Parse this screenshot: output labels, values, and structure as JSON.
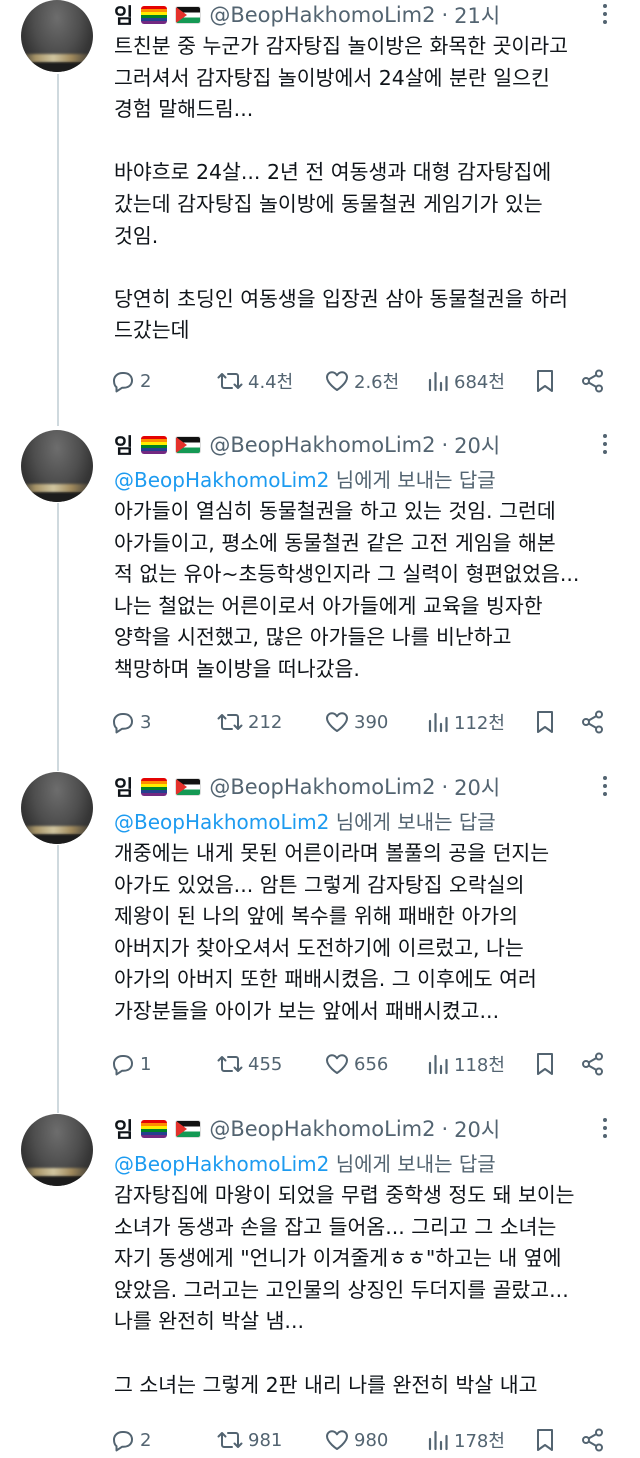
{
  "tweets": [
    {
      "name": "임",
      "handle": "@BeopHakhomoLim2",
      "time": "21시",
      "reply_to": null,
      "reply_to_suffix": null,
      "lines": [
        "트친분 중 누군가 감자탕집 놀이방은 화목한 곳이라고",
        "그러셔서 감자탕집 놀이방에서 24살에 분란 일으킨",
        "경험 말해드림...",
        "",
        "바야흐로 24살... 2년 전 여동생과 대형 감자탕집에",
        "갔는데 감자탕집 놀이방에 동물철권 게임기가 있는",
        "것임.",
        "",
        "당연히 초딩인 여동생을 입장권 삼아 동물철권을 하러",
        "드갔는데"
      ],
      "replies": "2",
      "retweets": "4.4천",
      "likes": "2.6천",
      "views": "684천"
    },
    {
      "name": "임",
      "handle": "@BeopHakhomoLim2",
      "time": "20시",
      "reply_to": "@BeopHakhomoLim2",
      "reply_to_suffix": "님에게 보내는 답글",
      "lines": [
        "아가들이 열심히 동물철권을 하고 있는 것임. 그런데",
        "아가들이고, 평소에 동물철권 같은 고전 게임을 해본",
        "적 없는 유아~초등학생인지라 그 실력이 형편없었음...",
        "나는 철없는 어른이로서 아가들에게 교육을 빙자한",
        "양학을 시전했고, 많은 아가들은 나를 비난하고",
        "책망하며 놀이방을 떠나갔음."
      ],
      "replies": "3",
      "retweets": "212",
      "likes": "390",
      "views": "112천"
    },
    {
      "name": "임",
      "handle": "@BeopHakhomoLim2",
      "time": "20시",
      "reply_to": "@BeopHakhomoLim2",
      "reply_to_suffix": "님에게 보내는 답글",
      "lines": [
        "개중에는 내게 못된 어른이라며 볼풀의 공을 던지는",
        "아가도 있었음... 암튼 그렇게 감자탕집 오락실의",
        "제왕이 된 나의 앞에 복수를 위해 패배한 아가의",
        "아버지가 찾아오셔서 도전하기에 이르렀고, 나는",
        "아가의 아버지 또한 패배시켰음. 그 이후에도 여러",
        "가장분들을 아이가 보는 앞에서 패배시켰고..."
      ],
      "replies": "1",
      "retweets": "455",
      "likes": "656",
      "views": "118천"
    },
    {
      "name": "임",
      "handle": "@BeopHakhomoLim2",
      "time": "20시",
      "reply_to": "@BeopHakhomoLim2",
      "reply_to_suffix": "님에게 보내는 답글",
      "lines": [
        "감자탕집에 마왕이 되었을 무렵 중학생 정도 돼 보이는",
        "소녀가 동생과 손을 잡고 들어옴... 그리고 그 소녀는",
        "자기 동생에게 \"언니가 이겨줄게ㅎㅎ\"하고는 내 옆에",
        "앉았음. 그러고는 고인물의 상징인 두더지를 골랐고...",
        "나를 완전히 박살 냄...",
        "",
        "그 소녀는 그렇게 2판 내리 나를 완전히 박살 내고"
      ],
      "replies": "2",
      "retweets": "981",
      "likes": "980",
      "views": "178천"
    }
  ]
}
